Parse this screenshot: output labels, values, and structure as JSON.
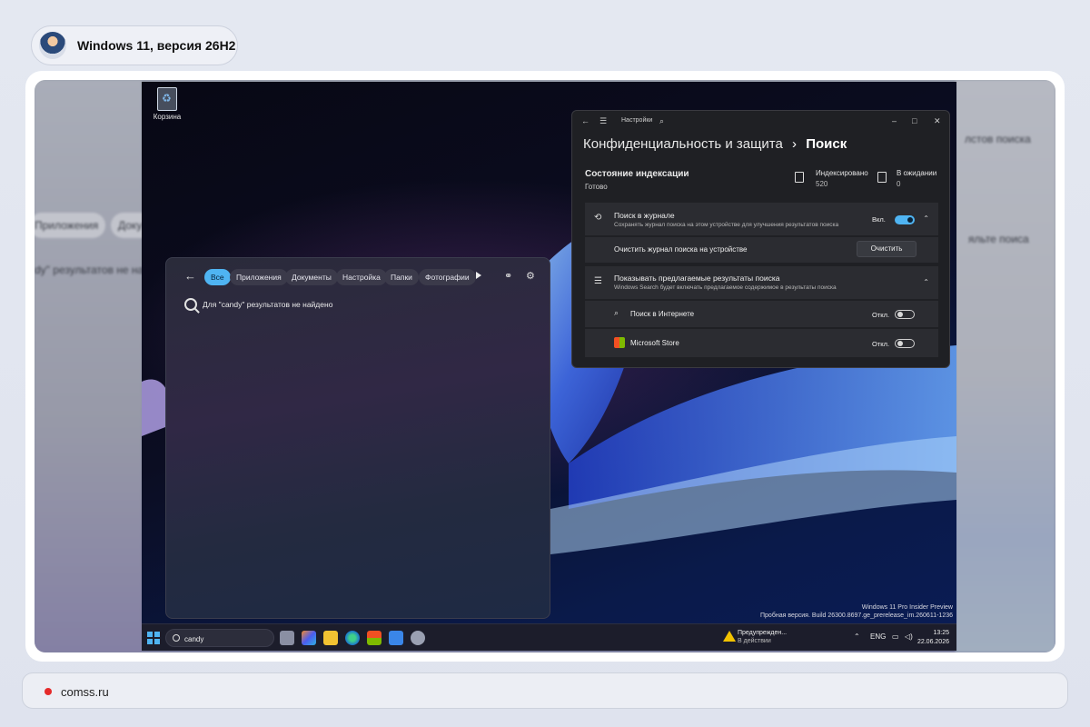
{
  "header": {
    "title": "Windows 11, версия 26H2",
    "avatar_icon": "mascot-avatar"
  },
  "footer": {
    "site": "comss.ru",
    "dot_color": "#e52a2a"
  },
  "blurred_background": {
    "left_chips": [
      "Приложения",
      "Доку"
    ],
    "left_text": "dy\" результатов не на",
    "right_text_1": "лстов поиска",
    "right_text_2": "яльте поиса"
  },
  "desktop": {
    "recycle_bin_label": "Корзина",
    "watermark_line1": "Windows 11 Pro Insider Preview",
    "watermark_line2": "Пробная версия. Build 26300.8697.ge_prerelease_im.260611-1236"
  },
  "search_panel": {
    "tabs": [
      "Все",
      "Приложения",
      "Документы",
      "Настройка",
      "Папки",
      "Фотографии"
    ],
    "active_tab": "Все",
    "no_results_text": "Для \"candy\" результатов не найдено"
  },
  "settings": {
    "app_title": "Настройки",
    "breadcrumb_parent": "Конфиденциальность и защита",
    "breadcrumb_separator": "›",
    "breadcrumb_current": "Поиск",
    "indexing": {
      "title": "Состояние индексации",
      "status": "Готово",
      "indexed_label": "Индексировано",
      "indexed_value": "520",
      "pending_label": "В ожидании",
      "pending_value": "0"
    },
    "history": {
      "title": "Поиск в журнале",
      "subtitle": "Сохранять журнал поиска на этом устройстве для улучшения результатов поиска",
      "state": "Вкл.",
      "clear_label": "Очистить журнал поиска на устройстве",
      "clear_button": "Очистить"
    },
    "suggested": {
      "title": "Показывать предлагаемые результаты поиска",
      "subtitle": "Windows Search будет включать предлагаемое содержимое в результаты поиска",
      "web_label": "Поиск в Интернете",
      "web_state": "Откл.",
      "store_label": "Microsoft Store",
      "store_state": "Откл."
    }
  },
  "taskbar": {
    "search_value": "candy",
    "warning_line1": "Предупрежден...",
    "warning_line2": "В действии",
    "language": "ENG",
    "time": "13:25",
    "date": "22.06.2026"
  }
}
